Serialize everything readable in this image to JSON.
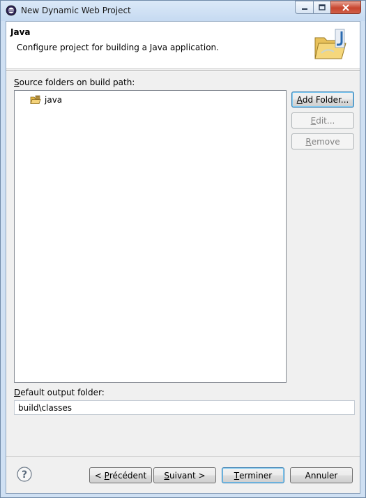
{
  "window": {
    "title": "New Dynamic Web Project"
  },
  "banner": {
    "title": "Java",
    "description": "Configure project for building a Java application."
  },
  "source": {
    "label_mnemonic": "S",
    "label_rest": "ource folders on build path:",
    "folders": [
      "java"
    ]
  },
  "buttons": {
    "add_folder": {
      "mnemonic": "A",
      "rest": "dd Folder..."
    },
    "edit": {
      "mnemonic": "E",
      "rest": "dit..."
    },
    "remove": {
      "mnemonic": "R",
      "rest": "emove"
    }
  },
  "output": {
    "label_mnemonic": "D",
    "label_rest": "efault output folder:",
    "value": "build\\classes"
  },
  "footer": {
    "back": {
      "pre": "< ",
      "mnemonic": "P",
      "rest": "récédent"
    },
    "next": {
      "mnemonic": "S",
      "rest": "uivant >"
    },
    "finish": {
      "mnemonic": "T",
      "rest": "erminer"
    },
    "cancel": "Annuler"
  },
  "icons": {
    "app": "eclipse-icon",
    "banner": "java-folder-icon",
    "folder": "package-folder-icon",
    "help": "help-icon"
  }
}
